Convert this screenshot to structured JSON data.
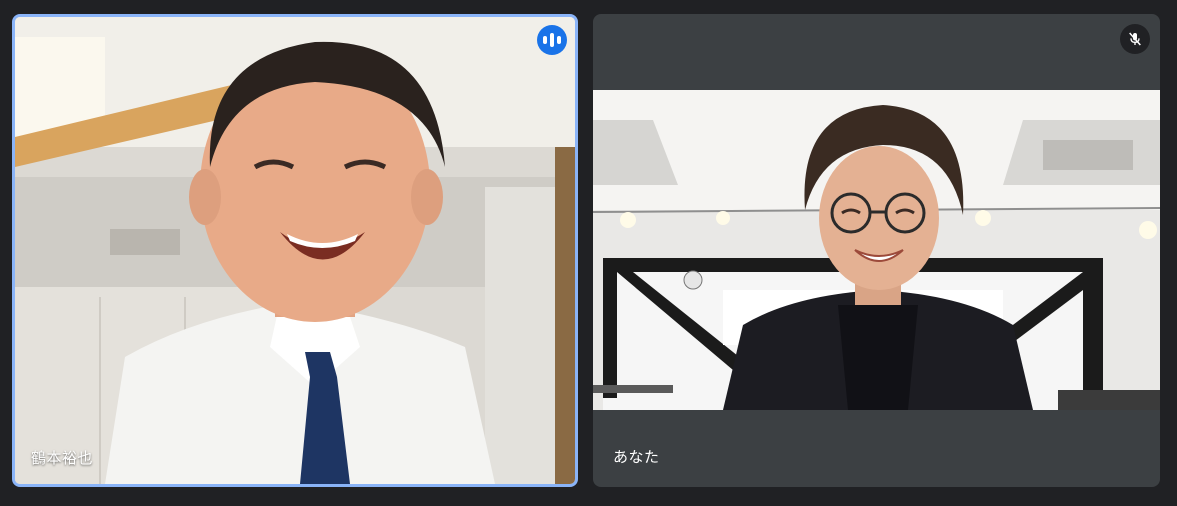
{
  "participants": [
    {
      "name": "鶴本裕也",
      "status": "speaking",
      "icon": "audio-bars-icon",
      "accent": "#8ab4f8"
    },
    {
      "name": "あなた",
      "status": "muted",
      "icon": "mic-off-icon"
    }
  ],
  "colors": {
    "background": "#202124",
    "tile": "#3c4043",
    "speaking_badge": "#1a73e8",
    "active_border": "#8ab4f8"
  }
}
